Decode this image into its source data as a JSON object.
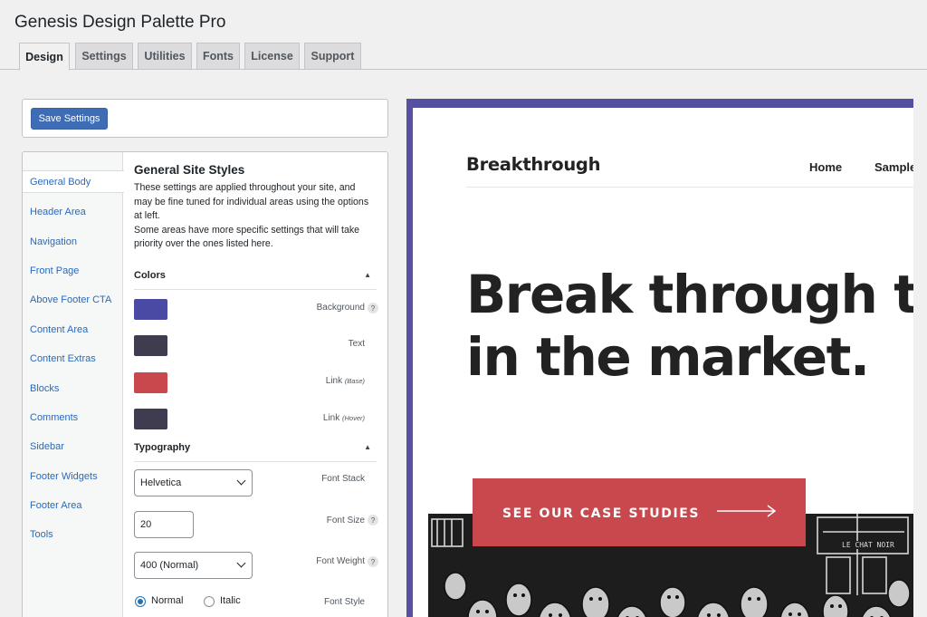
{
  "app": {
    "title": "Genesis Design Palette Pro"
  },
  "tabs": [
    {
      "label": "Design",
      "active": true
    },
    {
      "label": "Settings",
      "active": false
    },
    {
      "label": "Utilities",
      "active": false
    },
    {
      "label": "Fonts",
      "active": false
    },
    {
      "label": "License",
      "active": false
    },
    {
      "label": "Support",
      "active": false
    }
  ],
  "toolbar": {
    "save_label": "Save Settings"
  },
  "sidebar": {
    "items": [
      {
        "label": "General Body",
        "active": true
      },
      {
        "label": "Header Area"
      },
      {
        "label": "Navigation"
      },
      {
        "label": "Front Page"
      },
      {
        "label": "Above Footer CTA"
      },
      {
        "label": "Content Area"
      },
      {
        "label": "Content Extras"
      },
      {
        "label": "Blocks"
      },
      {
        "label": "Comments"
      },
      {
        "label": "Sidebar"
      },
      {
        "label": "Footer Widgets"
      },
      {
        "label": "Footer Area"
      },
      {
        "label": "Tools"
      }
    ]
  },
  "section": {
    "title": "General Site Styles",
    "desc1": "These settings are applied throughout your site, and may be fine tuned for individual areas using the options at left.",
    "desc2": "Some areas have more specific settings that will take priority over the ones listed here."
  },
  "colors": {
    "heading": "Colors",
    "items": [
      {
        "label": "Background",
        "note": "",
        "color": "#4a4aa5",
        "help": true
      },
      {
        "label": "Text",
        "note": "",
        "color": "#403c50",
        "help": false
      },
      {
        "label": "Link",
        "note": "(Base)",
        "color": "#c8484d",
        "help": false
      },
      {
        "label": "Link",
        "note": "(Hover)",
        "color": "#403c50",
        "help": false
      }
    ]
  },
  "typography": {
    "heading": "Typography",
    "font_stack": {
      "value": "Helvetica",
      "label": "Font Stack"
    },
    "font_size": {
      "value": "20",
      "label": "Font Size"
    },
    "font_weight": {
      "value": "400 (Normal)",
      "label": "Font Weight"
    },
    "font_style": {
      "label": "Font Style",
      "options": [
        "Normal",
        "Italic"
      ],
      "selected": "Normal"
    }
  },
  "help_glyph": "?",
  "preview": {
    "logo": "Breakthrough",
    "nav": [
      "Home",
      "Sample"
    ],
    "hero_line1": "Break through t",
    "hero_line2": "in the market.",
    "cta": "SEE OUR CASE STUDIES",
    "illustration_sign": "LE CHAT NOIR",
    "frame_color": "#5550a0",
    "cta_color": "#c8484d"
  }
}
